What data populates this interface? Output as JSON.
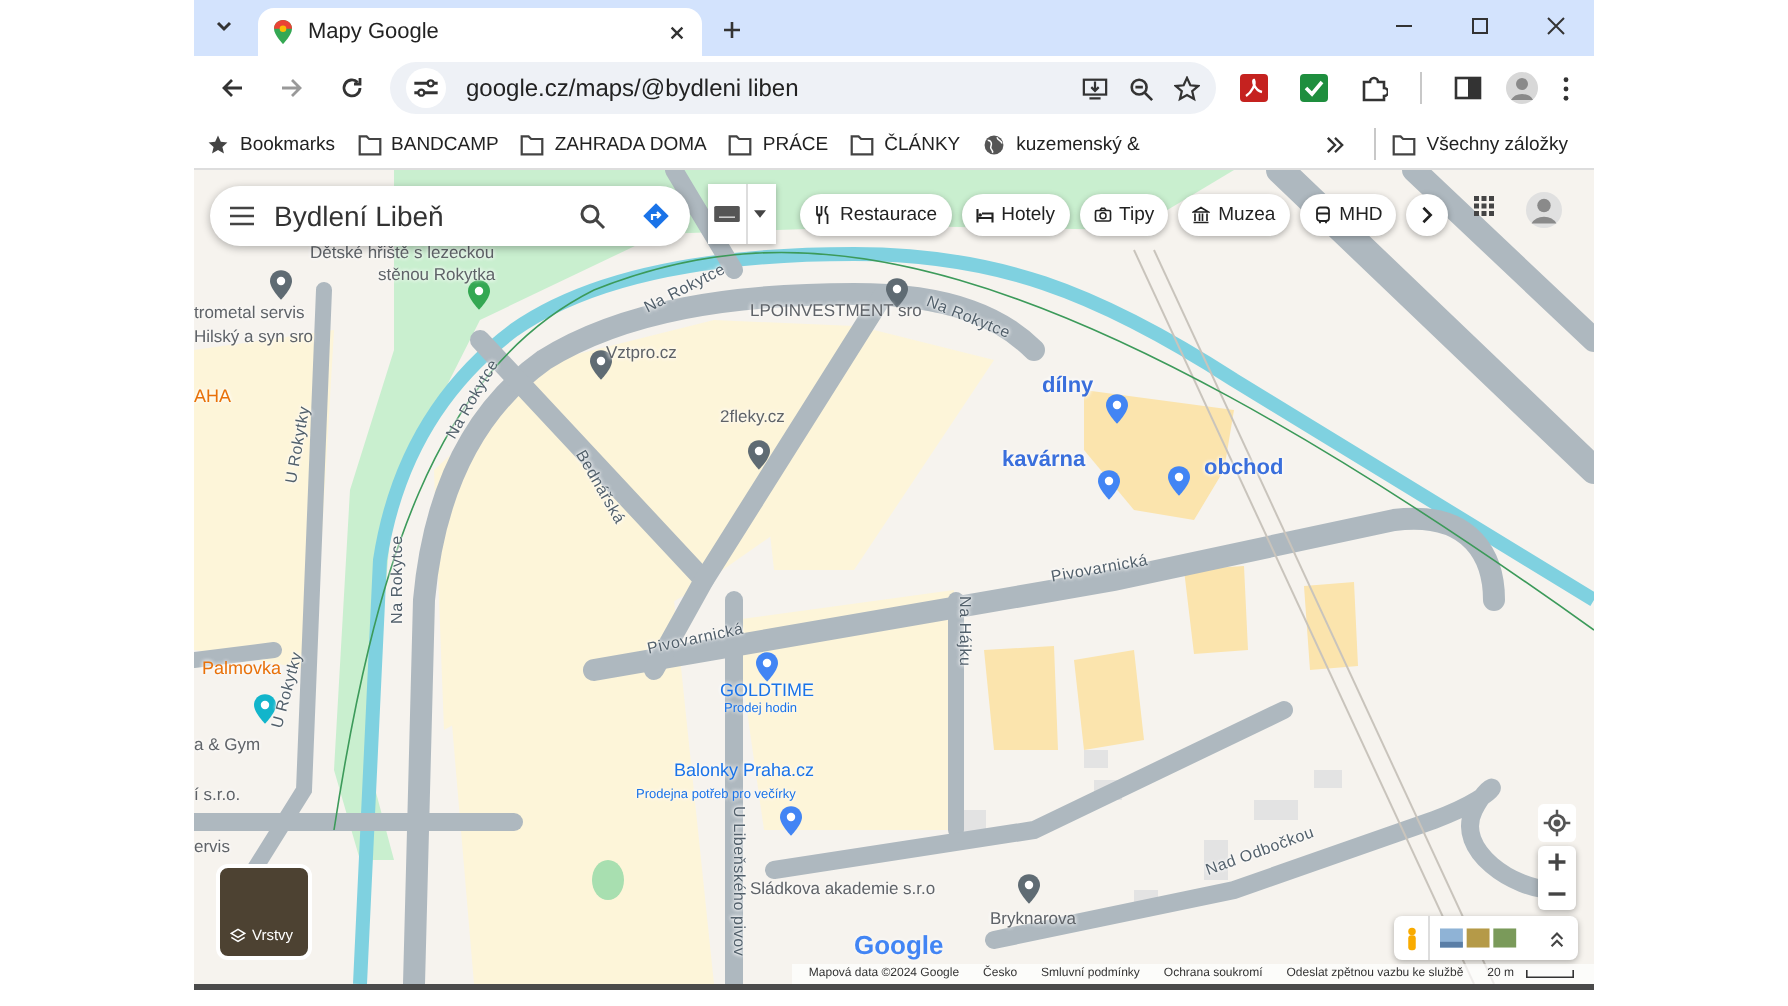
{
  "browser": {
    "tabs": [
      {
        "title": "Mapy Google",
        "selected": true
      }
    ],
    "address": "google.cz/maps/@bydleni liben",
    "bookmarks": [
      {
        "label": "Bookmarks",
        "kind": "star"
      },
      {
        "label": "BANDCAMP",
        "kind": "folder"
      },
      {
        "label": "ZAHRADA DOMA",
        "kind": "folder"
      },
      {
        "label": "PRÁCE",
        "kind": "folder"
      },
      {
        "label": "ČLÁNKY",
        "kind": "folder"
      },
      {
        "label": "kuzemenský &",
        "kind": "globe"
      }
    ],
    "all_bookmarks": "Všechny záložky"
  },
  "search": {
    "value": "Bydlení Libeň"
  },
  "chips": [
    {
      "label": "Restaurace",
      "kind": "restaurant"
    },
    {
      "label": "Hotely",
      "kind": "hotel"
    },
    {
      "label": "Tipy",
      "kind": "camera"
    },
    {
      "label": "Muzea",
      "kind": "museum"
    },
    {
      "label": "MHD",
      "kind": "bus"
    }
  ],
  "labels": [
    {
      "text": "Dětské hřiště s lezeckou",
      "kind": "place"
    },
    {
      "text": "stěnou Rokytka",
      "kind": "place"
    },
    {
      "text": "trometal servis",
      "kind": "place"
    },
    {
      "text": "Hilský a syn sro",
      "kind": "place"
    },
    {
      "text": "AHA",
      "kind": "district"
    },
    {
      "text": "Palmovka",
      "kind": "district"
    },
    {
      "text": "a & Gym",
      "kind": "place"
    },
    {
      "text": "í s.r.o.",
      "kind": "place"
    },
    {
      "text": "ervis",
      "kind": "place"
    },
    {
      "text": "Vztpro.cz",
      "kind": "place"
    },
    {
      "text": "LPOINVESTMENT sro",
      "kind": "place"
    },
    {
      "text": "2fleky.cz",
      "kind": "place"
    },
    {
      "text": "GOLDTIME",
      "kind": "shop"
    },
    {
      "text": "Prodej hodin",
      "kind": "shop-note"
    },
    {
      "text": "Balonky Praha.cz",
      "kind": "shop"
    },
    {
      "text": "Prodejna potřeb pro večírky",
      "kind": "shop-note"
    },
    {
      "text": "Sládkova akademie s.r.o",
      "kind": "place"
    },
    {
      "text": "Bryknarova",
      "kind": "place"
    },
    {
      "text": "dílny",
      "kind": "custom"
    },
    {
      "text": "kavárna",
      "kind": "custom"
    },
    {
      "text": "obchod",
      "kind": "custom"
    },
    {
      "text": "Na Rokytce",
      "kind": "street"
    },
    {
      "text": "Na Rokytce",
      "kind": "street"
    },
    {
      "text": "Na Rokytce",
      "kind": "street"
    },
    {
      "text": "Na Rokytce",
      "kind": "street"
    },
    {
      "text": "Bednářská",
      "kind": "street"
    },
    {
      "text": "U Rokytky",
      "kind": "street"
    },
    {
      "text": "U Rokytky",
      "kind": "street"
    },
    {
      "text": "Pivovarnická",
      "kind": "street"
    },
    {
      "text": "Pivovarnická",
      "kind": "street"
    },
    {
      "text": "Na Hájku",
      "kind": "street"
    },
    {
      "text": "U Libeňského pivov",
      "kind": "street"
    },
    {
      "text": "Nad Odbočkou",
      "kind": "street"
    }
  ],
  "layers": "Vrstvy",
  "logo": "Google",
  "footer": [
    "Mapová data ©2024 Google",
    "Česko",
    "Smluvní podmínky",
    "Ochrana soukromí",
    "Odeslat zpětnou vazbu ke službě"
  ],
  "scale": "20 m"
}
